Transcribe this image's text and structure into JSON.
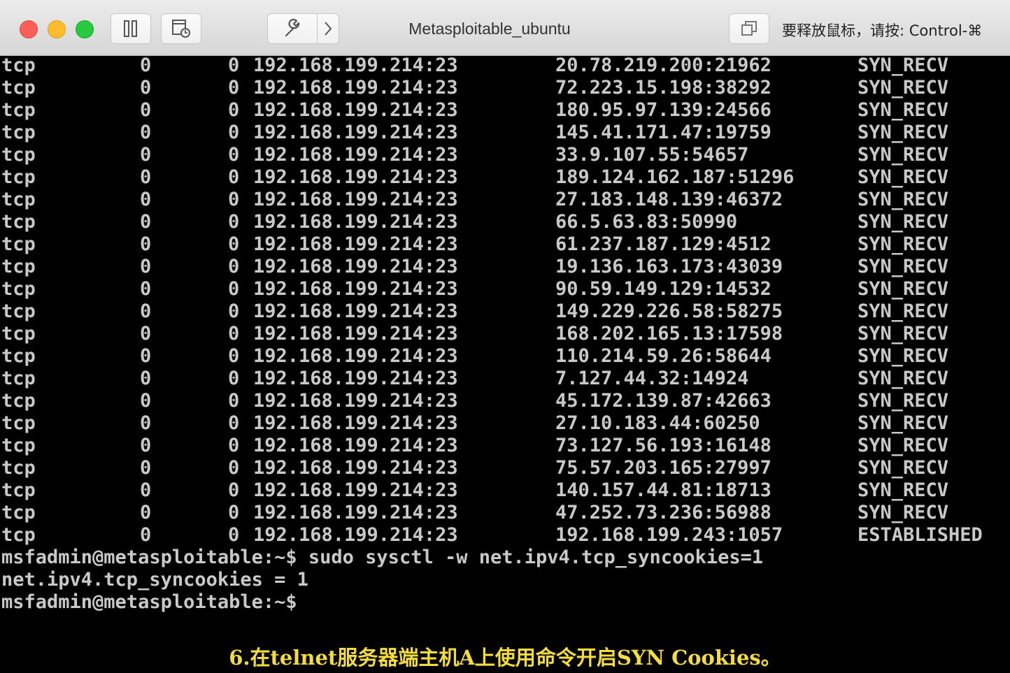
{
  "window": {
    "title": "Metasploitable_ubuntu",
    "release_hint": "要释放鼠标，请按: Control-⌘",
    "toolbar_icons": [
      "pause-icon",
      "snapshot-icon",
      "wrench-icon",
      "chevron-right-icon",
      "window-icon"
    ]
  },
  "terminal": {
    "connections": [
      {
        "proto": "tcp",
        "recv_q": "0",
        "send_q": "0",
        "local": "192.168.199.214:23",
        "foreign": "20.78.219.200:21962",
        "state": "SYN_RECV"
      },
      {
        "proto": "tcp",
        "recv_q": "0",
        "send_q": "0",
        "local": "192.168.199.214:23",
        "foreign": "72.223.15.198:38292",
        "state": "SYN_RECV"
      },
      {
        "proto": "tcp",
        "recv_q": "0",
        "send_q": "0",
        "local": "192.168.199.214:23",
        "foreign": "180.95.97.139:24566",
        "state": "SYN_RECV"
      },
      {
        "proto": "tcp",
        "recv_q": "0",
        "send_q": "0",
        "local": "192.168.199.214:23",
        "foreign": "145.41.171.47:19759",
        "state": "SYN_RECV"
      },
      {
        "proto": "tcp",
        "recv_q": "0",
        "send_q": "0",
        "local": "192.168.199.214:23",
        "foreign": "33.9.107.55:54657",
        "state": "SYN_RECV"
      },
      {
        "proto": "tcp",
        "recv_q": "0",
        "send_q": "0",
        "local": "192.168.199.214:23",
        "foreign": "189.124.162.187:51296",
        "state": "SYN_RECV"
      },
      {
        "proto": "tcp",
        "recv_q": "0",
        "send_q": "0",
        "local": "192.168.199.214:23",
        "foreign": "27.183.148.139:46372",
        "state": "SYN_RECV"
      },
      {
        "proto": "tcp",
        "recv_q": "0",
        "send_q": "0",
        "local": "192.168.199.214:23",
        "foreign": "66.5.63.83:50990",
        "state": "SYN_RECV"
      },
      {
        "proto": "tcp",
        "recv_q": "0",
        "send_q": "0",
        "local": "192.168.199.214:23",
        "foreign": "61.237.187.129:4512",
        "state": "SYN_RECV"
      },
      {
        "proto": "tcp",
        "recv_q": "0",
        "send_q": "0",
        "local": "192.168.199.214:23",
        "foreign": "19.136.163.173:43039",
        "state": "SYN_RECV"
      },
      {
        "proto": "tcp",
        "recv_q": "0",
        "send_q": "0",
        "local": "192.168.199.214:23",
        "foreign": "90.59.149.129:14532",
        "state": "SYN_RECV"
      },
      {
        "proto": "tcp",
        "recv_q": "0",
        "send_q": "0",
        "local": "192.168.199.214:23",
        "foreign": "149.229.226.58:58275",
        "state": "SYN_RECV"
      },
      {
        "proto": "tcp",
        "recv_q": "0",
        "send_q": "0",
        "local": "192.168.199.214:23",
        "foreign": "168.202.165.13:17598",
        "state": "SYN_RECV"
      },
      {
        "proto": "tcp",
        "recv_q": "0",
        "send_q": "0",
        "local": "192.168.199.214:23",
        "foreign": "110.214.59.26:58644",
        "state": "SYN_RECV"
      },
      {
        "proto": "tcp",
        "recv_q": "0",
        "send_q": "0",
        "local": "192.168.199.214:23",
        "foreign": "7.127.44.32:14924",
        "state": "SYN_RECV"
      },
      {
        "proto": "tcp",
        "recv_q": "0",
        "send_q": "0",
        "local": "192.168.199.214:23",
        "foreign": "45.172.139.87:42663",
        "state": "SYN_RECV"
      },
      {
        "proto": "tcp",
        "recv_q": "0",
        "send_q": "0",
        "local": "192.168.199.214:23",
        "foreign": "27.10.183.44:60250",
        "state": "SYN_RECV"
      },
      {
        "proto": "tcp",
        "recv_q": "0",
        "send_q": "0",
        "local": "192.168.199.214:23",
        "foreign": "73.127.56.193:16148",
        "state": "SYN_RECV"
      },
      {
        "proto": "tcp",
        "recv_q": "0",
        "send_q": "0",
        "local": "192.168.199.214:23",
        "foreign": "75.57.203.165:27997",
        "state": "SYN_RECV"
      },
      {
        "proto": "tcp",
        "recv_q": "0",
        "send_q": "0",
        "local": "192.168.199.214:23",
        "foreign": "140.157.44.81:18713",
        "state": "SYN_RECV"
      },
      {
        "proto": "tcp",
        "recv_q": "0",
        "send_q": "0",
        "local": "192.168.199.214:23",
        "foreign": "47.252.73.236:56988",
        "state": "SYN_RECV"
      },
      {
        "proto": "tcp",
        "recv_q": "0",
        "send_q": "0",
        "local": "192.168.199.214:23",
        "foreign": "192.168.199.243:1057",
        "state": "ESTABLISHED"
      }
    ],
    "lines": [
      "msfadmin@metasploitable:~$ sudo sysctl -w net.ipv4.tcp_syncookies=1",
      "net.ipv4.tcp_syncookies = 1",
      "msfadmin@metasploitable:~$"
    ]
  },
  "caption": "6.在telnet服务器端主机A上使用命令开启SYN Cookies。"
}
